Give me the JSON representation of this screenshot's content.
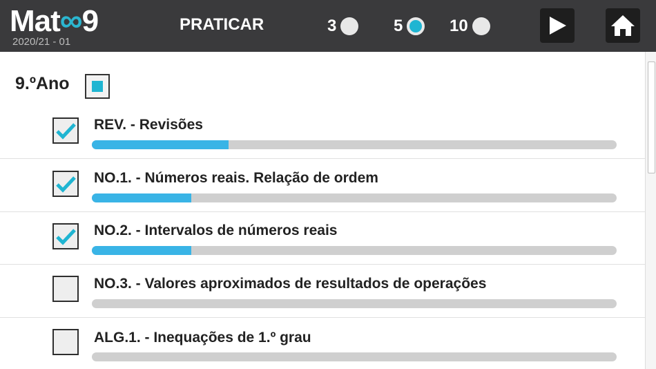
{
  "header": {
    "logo_text_start": "Mat",
    "logo_infinity": "∞",
    "logo_text_end": "9",
    "version": "2020/21 - 01",
    "title": "PRATICAR",
    "options": [
      {
        "label": "3",
        "selected": false
      },
      {
        "label": "5",
        "selected": true
      },
      {
        "label": "10",
        "selected": false
      }
    ],
    "play_icon": "play-icon",
    "home_icon": "home-icon"
  },
  "section": {
    "year_label": "9.ºAno",
    "year_selected": "partial"
  },
  "topics": [
    {
      "label": "REV. - Revisões",
      "checked": true,
      "progress": 0.26
    },
    {
      "label": "NO.1. - Números reais. Relação de ordem",
      "checked": true,
      "progress": 0.19
    },
    {
      "label": "NO.2. - Intervalos de números reais",
      "checked": true,
      "progress": 0.19
    },
    {
      "label": "NO.3. - Valores aproximados de resultados de operações",
      "checked": false,
      "progress": 0.0
    },
    {
      "label": "ALG.1. - Inequações de 1.º grau",
      "checked": false,
      "progress": 0.0
    }
  ],
  "colors": {
    "header_bg": "#3a3a3c",
    "accent": "#1fb5d2",
    "progress": "#39b4e6",
    "track": "#cfcfcf"
  }
}
